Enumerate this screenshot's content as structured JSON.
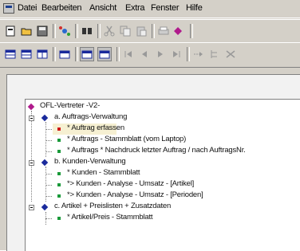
{
  "menubar": {
    "items": [
      "Datei",
      "Bearbeiten",
      "Ansicht",
      "Extra",
      "Fenster",
      "Hilfe"
    ]
  },
  "tree": {
    "root": "OFL-Vertreter -V2-",
    "groups": [
      {
        "label": "a. Auftrags-Verwaltung",
        "items": [
          "* Auftrag erfassen",
          "* Auftrags - Stammblatt (vom Laptop)",
          "* Auftrags * Nachdruck letzter Auftrag / nach AuftragsNr."
        ]
      },
      {
        "label": "b. Kunden-Verwaltung",
        "items": [
          "* Kunden - Stammblatt",
          "*> Kunden - Analyse - Umsatz - [Artikel]",
          "*> Kunden - Analyse - Umsatz - [Perioden]"
        ]
      },
      {
        "label": "c. Artikel + Preislisten + Zusatzdaten",
        "items": [
          "* Artikel/Preis - Stammblatt"
        ]
      }
    ]
  },
  "colors": {
    "root_diamond": "#b01a8c",
    "group_diamond": "#1a2a9c",
    "item_red": "#d01818",
    "item_green": "#1a9a3a"
  },
  "icons": {
    "toolbar1": [
      "new-icon",
      "open-icon",
      "save-icon",
      "network-icon",
      "find-icon",
      "cut-icon",
      "copy-icon",
      "paste-icon",
      "print-icon",
      "diamond-icon"
    ],
    "toolbar2": [
      "table-icon",
      "form-icon",
      "columns-icon",
      "window-icon",
      "view1-icon",
      "view2-icon",
      "first-icon",
      "prev-icon",
      "next-icon",
      "last-icon",
      "insert-icon",
      "tree-icon",
      "delete-icon"
    ]
  }
}
